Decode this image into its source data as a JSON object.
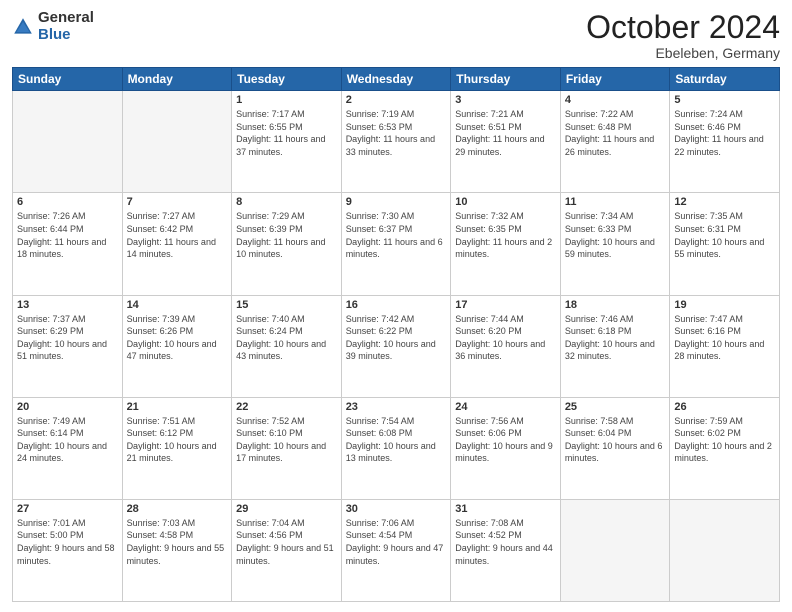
{
  "header": {
    "logo_general": "General",
    "logo_blue": "Blue",
    "month_title": "October 2024",
    "location": "Ebeleben, Germany"
  },
  "weekdays": [
    "Sunday",
    "Monday",
    "Tuesday",
    "Wednesday",
    "Thursday",
    "Friday",
    "Saturday"
  ],
  "weeks": [
    [
      {
        "day": "",
        "info": ""
      },
      {
        "day": "",
        "info": ""
      },
      {
        "day": "1",
        "info": "Sunrise: 7:17 AM\nSunset: 6:55 PM\nDaylight: 11 hours and 37 minutes."
      },
      {
        "day": "2",
        "info": "Sunrise: 7:19 AM\nSunset: 6:53 PM\nDaylight: 11 hours and 33 minutes."
      },
      {
        "day": "3",
        "info": "Sunrise: 7:21 AM\nSunset: 6:51 PM\nDaylight: 11 hours and 29 minutes."
      },
      {
        "day": "4",
        "info": "Sunrise: 7:22 AM\nSunset: 6:48 PM\nDaylight: 11 hours and 26 minutes."
      },
      {
        "day": "5",
        "info": "Sunrise: 7:24 AM\nSunset: 6:46 PM\nDaylight: 11 hours and 22 minutes."
      }
    ],
    [
      {
        "day": "6",
        "info": "Sunrise: 7:26 AM\nSunset: 6:44 PM\nDaylight: 11 hours and 18 minutes."
      },
      {
        "day": "7",
        "info": "Sunrise: 7:27 AM\nSunset: 6:42 PM\nDaylight: 11 hours and 14 minutes."
      },
      {
        "day": "8",
        "info": "Sunrise: 7:29 AM\nSunset: 6:39 PM\nDaylight: 11 hours and 10 minutes."
      },
      {
        "day": "9",
        "info": "Sunrise: 7:30 AM\nSunset: 6:37 PM\nDaylight: 11 hours and 6 minutes."
      },
      {
        "day": "10",
        "info": "Sunrise: 7:32 AM\nSunset: 6:35 PM\nDaylight: 11 hours and 2 minutes."
      },
      {
        "day": "11",
        "info": "Sunrise: 7:34 AM\nSunset: 6:33 PM\nDaylight: 10 hours and 59 minutes."
      },
      {
        "day": "12",
        "info": "Sunrise: 7:35 AM\nSunset: 6:31 PM\nDaylight: 10 hours and 55 minutes."
      }
    ],
    [
      {
        "day": "13",
        "info": "Sunrise: 7:37 AM\nSunset: 6:29 PM\nDaylight: 10 hours and 51 minutes."
      },
      {
        "day": "14",
        "info": "Sunrise: 7:39 AM\nSunset: 6:26 PM\nDaylight: 10 hours and 47 minutes."
      },
      {
        "day": "15",
        "info": "Sunrise: 7:40 AM\nSunset: 6:24 PM\nDaylight: 10 hours and 43 minutes."
      },
      {
        "day": "16",
        "info": "Sunrise: 7:42 AM\nSunset: 6:22 PM\nDaylight: 10 hours and 39 minutes."
      },
      {
        "day": "17",
        "info": "Sunrise: 7:44 AM\nSunset: 6:20 PM\nDaylight: 10 hours and 36 minutes."
      },
      {
        "day": "18",
        "info": "Sunrise: 7:46 AM\nSunset: 6:18 PM\nDaylight: 10 hours and 32 minutes."
      },
      {
        "day": "19",
        "info": "Sunrise: 7:47 AM\nSunset: 6:16 PM\nDaylight: 10 hours and 28 minutes."
      }
    ],
    [
      {
        "day": "20",
        "info": "Sunrise: 7:49 AM\nSunset: 6:14 PM\nDaylight: 10 hours and 24 minutes."
      },
      {
        "day": "21",
        "info": "Sunrise: 7:51 AM\nSunset: 6:12 PM\nDaylight: 10 hours and 21 minutes."
      },
      {
        "day": "22",
        "info": "Sunrise: 7:52 AM\nSunset: 6:10 PM\nDaylight: 10 hours and 17 minutes."
      },
      {
        "day": "23",
        "info": "Sunrise: 7:54 AM\nSunset: 6:08 PM\nDaylight: 10 hours and 13 minutes."
      },
      {
        "day": "24",
        "info": "Sunrise: 7:56 AM\nSunset: 6:06 PM\nDaylight: 10 hours and 9 minutes."
      },
      {
        "day": "25",
        "info": "Sunrise: 7:58 AM\nSunset: 6:04 PM\nDaylight: 10 hours and 6 minutes."
      },
      {
        "day": "26",
        "info": "Sunrise: 7:59 AM\nSunset: 6:02 PM\nDaylight: 10 hours and 2 minutes."
      }
    ],
    [
      {
        "day": "27",
        "info": "Sunrise: 7:01 AM\nSunset: 5:00 PM\nDaylight: 9 hours and 58 minutes."
      },
      {
        "day": "28",
        "info": "Sunrise: 7:03 AM\nSunset: 4:58 PM\nDaylight: 9 hours and 55 minutes."
      },
      {
        "day": "29",
        "info": "Sunrise: 7:04 AM\nSunset: 4:56 PM\nDaylight: 9 hours and 51 minutes."
      },
      {
        "day": "30",
        "info": "Sunrise: 7:06 AM\nSunset: 4:54 PM\nDaylight: 9 hours and 47 minutes."
      },
      {
        "day": "31",
        "info": "Sunrise: 7:08 AM\nSunset: 4:52 PM\nDaylight: 9 hours and 44 minutes."
      },
      {
        "day": "",
        "info": ""
      },
      {
        "day": "",
        "info": ""
      }
    ]
  ]
}
